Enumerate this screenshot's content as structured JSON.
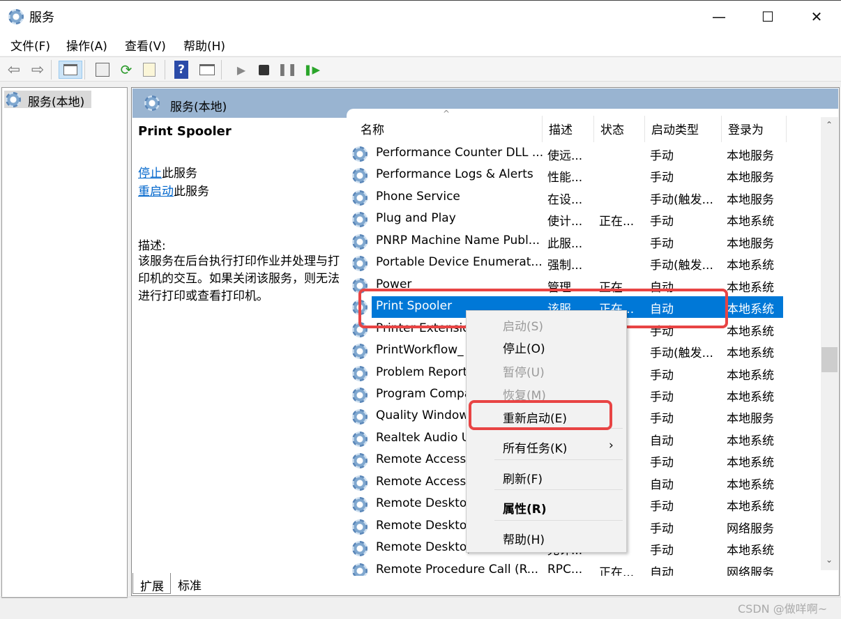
{
  "window": {
    "title": "服务",
    "minimize": "—",
    "maximize": "☐",
    "close": "✕"
  },
  "menu": [
    "文件(F)",
    "操作(A)",
    "查看(V)",
    "帮助(H)"
  ],
  "toolbar": {
    "icons": [
      "back-icon",
      "forward-icon",
      "show-tree-icon",
      "properties-icon",
      "refresh-icon",
      "export-icon",
      "help-icon",
      "show-action-pane-icon",
      "start-icon",
      "stop-icon",
      "pause-icon",
      "restart-icon"
    ]
  },
  "tree": {
    "root": "服务(本地)"
  },
  "panel": {
    "title": "服务(本地)"
  },
  "detail": {
    "name": "Print Spooler",
    "stop_link": "停止",
    "stop_suffix": "此服务",
    "restart_link": "重启动",
    "restart_suffix": "此服务",
    "desc_label": "描述:",
    "desc_text": "该服务在后台执行打印作业并处理与打印机的交互。如果关闭该服务，则无法进行打印或查看打印机。"
  },
  "columns": [
    "名称",
    "描述",
    "状态",
    "启动类型",
    "登录为"
  ],
  "rows": [
    {
      "name": "Performance Counter DLL ...",
      "desc": "使远...",
      "status": "",
      "startup": "手动",
      "logon": "本地服务"
    },
    {
      "name": "Performance Logs & Alerts",
      "desc": "性能...",
      "status": "",
      "startup": "手动",
      "logon": "本地服务"
    },
    {
      "name": "Phone Service",
      "desc": "在设...",
      "status": "",
      "startup": "手动(触发...",
      "logon": "本地服务"
    },
    {
      "name": "Plug and Play",
      "desc": "使计...",
      "status": "正在...",
      "startup": "手动",
      "logon": "本地系统"
    },
    {
      "name": "PNRP Machine Name Publ...",
      "desc": "此服...",
      "status": "",
      "startup": "手动",
      "logon": "本地服务"
    },
    {
      "name": "Portable Device Enumerat...",
      "desc": "强制...",
      "status": "",
      "startup": "手动(触发...",
      "logon": "本地系统"
    },
    {
      "name": "Power",
      "desc": "管理...",
      "status": "正在...",
      "startup": "自动",
      "logon": "本地系统"
    },
    {
      "name": "Print Spooler",
      "desc": "该服...",
      "status": "正在...",
      "startup": "自动",
      "logon": "本地系统",
      "selected": true
    },
    {
      "name": "Printer Extensio",
      "desc": "",
      "status": "",
      "startup": "手动",
      "logon": "本地系统"
    },
    {
      "name": "PrintWorkflow_",
      "desc": "",
      "status": "",
      "startup": "手动(触发...",
      "logon": "本地系统"
    },
    {
      "name": "Problem Report",
      "desc": "",
      "status": "",
      "startup": "手动",
      "logon": "本地系统"
    },
    {
      "name": "Program Compa",
      "desc": "",
      "status": "...",
      "startup": "手动",
      "logon": "本地系统"
    },
    {
      "name": "Quality Window",
      "desc": "",
      "status": "",
      "startup": "手动",
      "logon": "本地服务"
    },
    {
      "name": "Realtek Audio U",
      "desc": "",
      "status": "...",
      "startup": "自动",
      "logon": "本地系统"
    },
    {
      "name": "Remote Access",
      "desc": "",
      "status": "",
      "startup": "手动",
      "logon": "本地系统"
    },
    {
      "name": "Remote Access",
      "desc": "",
      "status": "...",
      "startup": "自动",
      "logon": "本地系统"
    },
    {
      "name": "Remote Deskto",
      "desc": "",
      "status": "",
      "startup": "手动",
      "logon": "本地系统"
    },
    {
      "name": "Remote Deskto",
      "desc": "",
      "status": "",
      "startup": "手动",
      "logon": "网络服务"
    },
    {
      "name": "Remote Desktop Services ...",
      "desc": "允许...",
      "status": "",
      "startup": "手动",
      "logon": "本地系统"
    },
    {
      "name": "Remote Procedure Call (R...",
      "desc": "RPC...",
      "status": "正在...",
      "startup": "自动",
      "logon": "网络服务"
    }
  ],
  "context_menu": [
    {
      "label": "启动(S)",
      "disabled": true
    },
    {
      "label": "停止(O)"
    },
    {
      "label": "暂停(U)",
      "disabled": true
    },
    {
      "label": "恢复(M)",
      "disabled": true
    },
    {
      "label": "重新启动(E)",
      "highlighted": true
    },
    {
      "label": "所有任务(K)",
      "submenu": "›"
    },
    {
      "label": "刷新(F)"
    },
    {
      "label": "属性(R)",
      "bold": true
    },
    {
      "label": "帮助(H)"
    }
  ],
  "tabs": [
    "扩展",
    "标准"
  ],
  "watermark": "CSDN @做咩啊~",
  "colors": {
    "selection": "#0078d7",
    "annotation": "#e84444",
    "band": "#99b4d1"
  }
}
